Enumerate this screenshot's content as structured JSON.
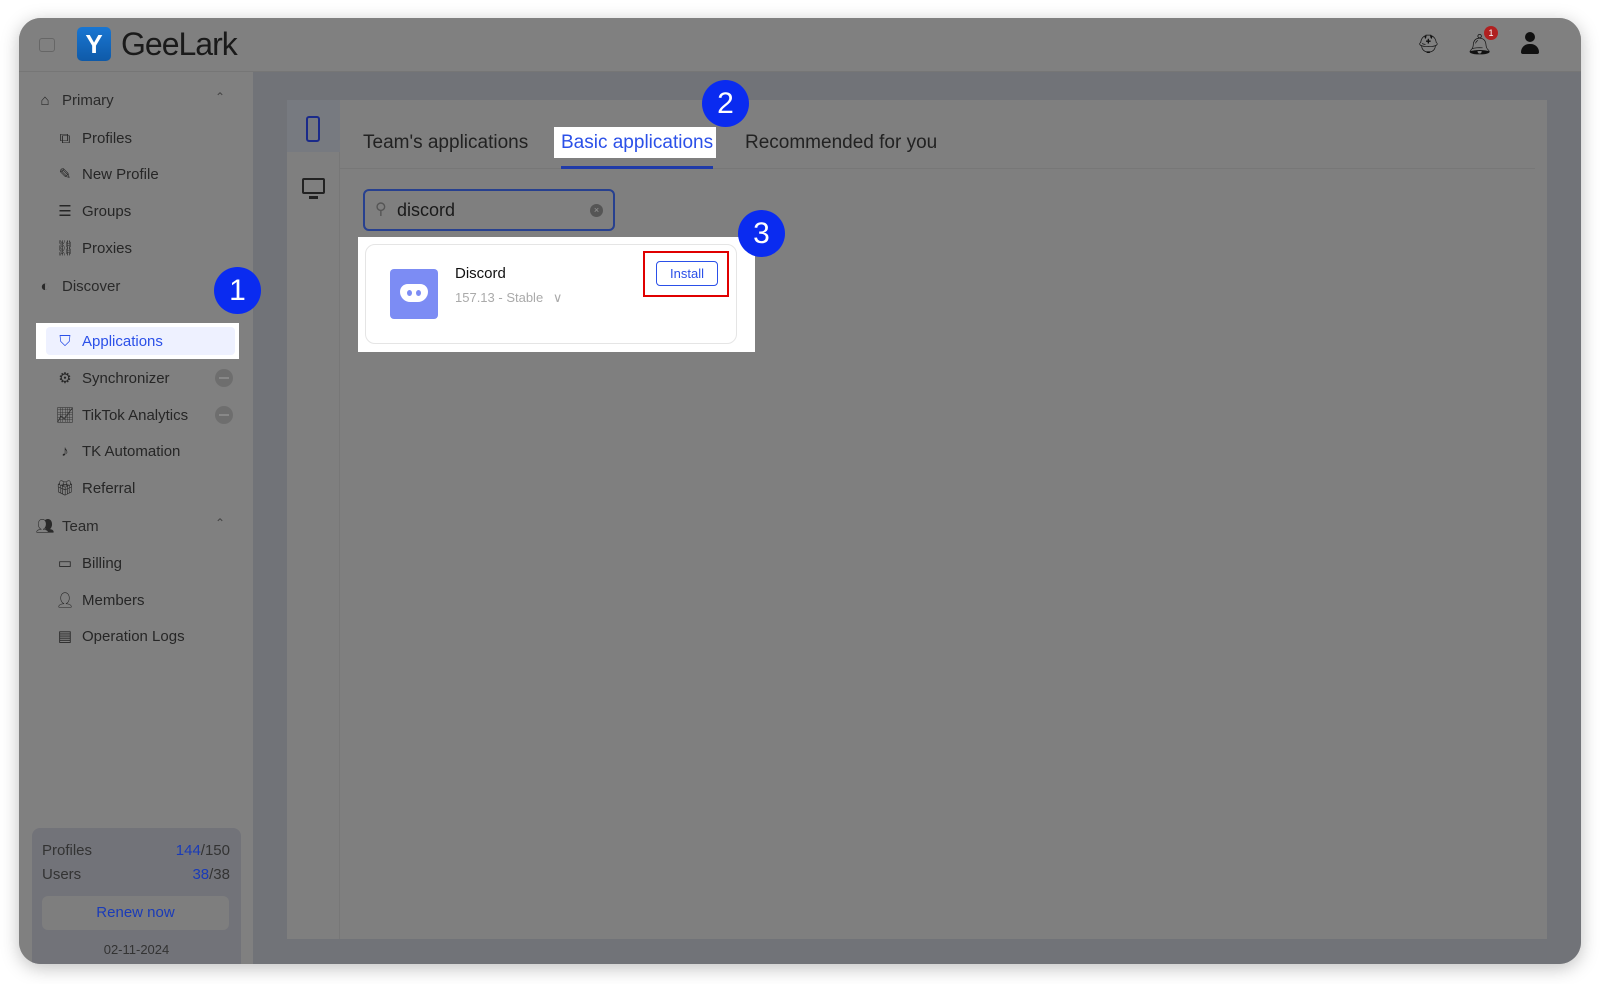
{
  "header": {
    "brand": "GeeLark",
    "notification_count": "1"
  },
  "sidebar": {
    "groups": [
      {
        "label": "Primary"
      },
      {
        "label": "Discover"
      },
      {
        "label": "Team"
      }
    ],
    "items": [
      {
        "label": "Profiles",
        "icon": "profiles-icon"
      },
      {
        "label": "New Profile",
        "icon": "edit-icon"
      },
      {
        "label": "Groups",
        "icon": "list-icon"
      },
      {
        "label": "Proxies",
        "icon": "proxy-icon"
      },
      {
        "label": "Applications",
        "icon": "applications-icon",
        "active": true
      },
      {
        "label": "Synchronizer",
        "icon": "sync-icon"
      },
      {
        "label": "TikTok Analytics",
        "icon": "chart-icon"
      },
      {
        "label": "TK Automation",
        "icon": "tiktok-icon"
      },
      {
        "label": "Referral",
        "icon": "gift-icon"
      },
      {
        "label": "Billing",
        "icon": "wallet-icon"
      },
      {
        "label": "Members",
        "icon": "member-icon"
      },
      {
        "label": "Operation Logs",
        "icon": "log-icon"
      }
    ],
    "quota": {
      "profiles_label": "Profiles",
      "profiles_used": "144",
      "profiles_total": "/150",
      "users_label": "Users",
      "users_used": "38",
      "users_total": "/38",
      "renew": "Renew now",
      "date": "02-11-2024"
    }
  },
  "tabs": [
    {
      "label": "Team's applications"
    },
    {
      "label": "Basic applications",
      "active": true
    },
    {
      "label": "Recommended for you"
    }
  ],
  "search": {
    "value": "discord"
  },
  "app": {
    "name": "Discord",
    "version": "157.13 - Stable",
    "install": "Install"
  },
  "steps": [
    "1",
    "2",
    "3"
  ],
  "colors": {
    "accent": "#2b50e8",
    "step_badge": "#0a2bf0",
    "highlight_box": "#e00000"
  }
}
